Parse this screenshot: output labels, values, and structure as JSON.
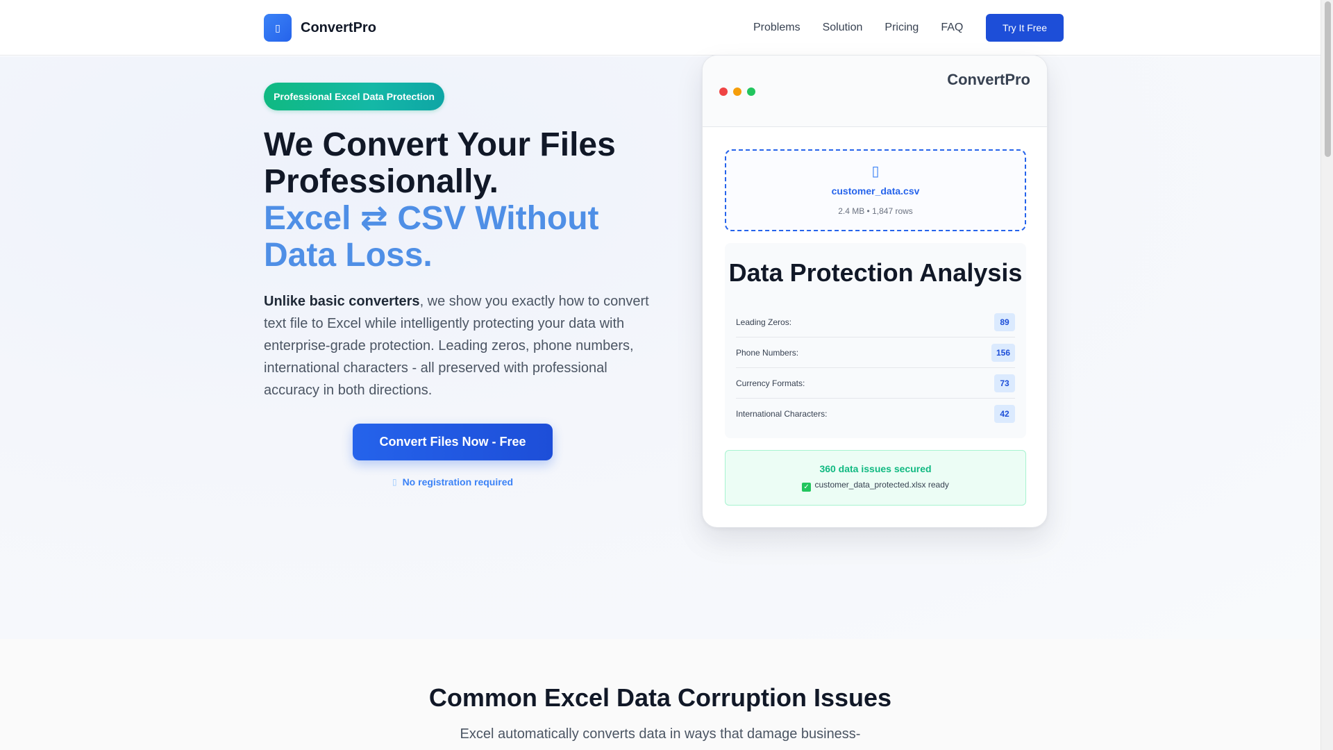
{
  "header": {
    "brand_name": "ConvertPro",
    "logo_icon": "file-convert-icon",
    "nav": [
      "Problems",
      "Solution",
      "Pricing",
      "FAQ"
    ],
    "cta_label": "Try It Free"
  },
  "hero": {
    "badge": "Professional Excel Data Protection",
    "title_line1": "We Convert Your Files Professionally.",
    "title_accent": "Excel ⇄ CSV Without Data Loss.",
    "desc_strong": "Unlike basic converters",
    "desc_rest": ", we show you exactly how to convert text file to Excel while intelligently protecting your data with enterprise-grade protection. Leading zeros, phone numbers, international characters - all preserved with professional accuracy in both directions.",
    "cta_label": "Convert Files Now - Free",
    "no_registration": "No registration required"
  },
  "mockup": {
    "title": "ConvertPro",
    "file_name": "customer_data.csv",
    "file_meta": "2.4 MB • 1,847 rows",
    "analysis_title": "Data Protection Analysis",
    "rows": [
      {
        "label": "Leading Zeros:",
        "value": "89"
      },
      {
        "label": "Phone Numbers:",
        "value": "156"
      },
      {
        "label": "Currency Formats:",
        "value": "73"
      },
      {
        "label": "International Characters:",
        "value": "42"
      }
    ],
    "secured_title": "360 data issues secured",
    "secured_file": "customer_data_protected.xlsx ready"
  },
  "issues": {
    "title": "Common Excel Data Corruption Issues",
    "subtitle": "Excel automatically converts data in ways that damage business-"
  },
  "colors": {
    "primary": "#1d4ed8",
    "accent_text": "#4f8fe6",
    "success": "#10b981"
  }
}
